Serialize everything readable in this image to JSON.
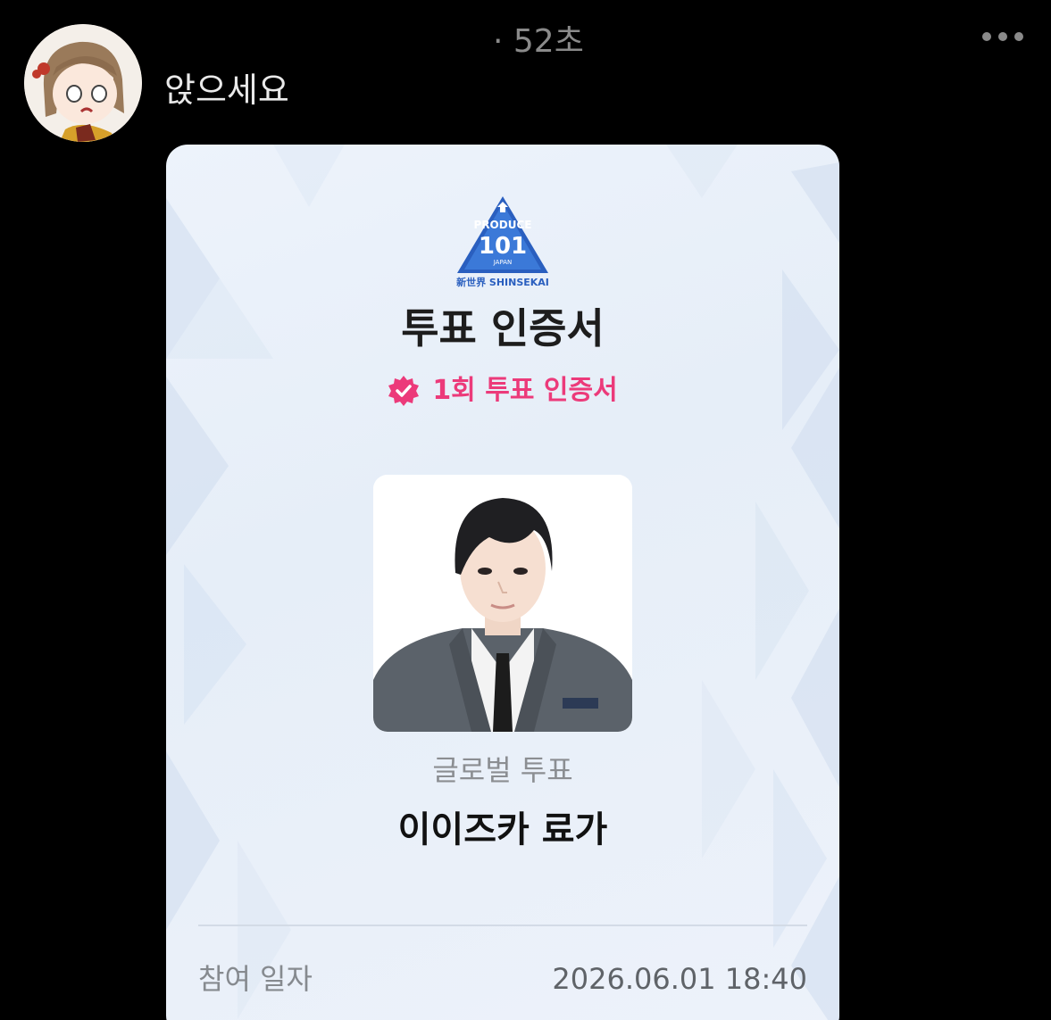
{
  "post": {
    "username": "앉으세요",
    "timestamp": "· 52초"
  },
  "card": {
    "logo": {
      "line1": "PRODUCE",
      "line2": "101",
      "line3": "JAPAN",
      "line4": "新世界 SHINSEKAI"
    },
    "title": "투표 인증서",
    "badge_text": "1회 투표 인증서",
    "vote_type": "글로벌 투표",
    "trainee_name": "이이즈카 료가",
    "date_label": "참여 일자",
    "date_value": "2026.06.01 18:40"
  },
  "icons": {
    "more": "more-horizontal-icon",
    "badge": "verified-badge-icon"
  },
  "colors": {
    "background": "#000000",
    "accent_pink": "#ec3a7a",
    "logo_blue": "#2563c7"
  }
}
